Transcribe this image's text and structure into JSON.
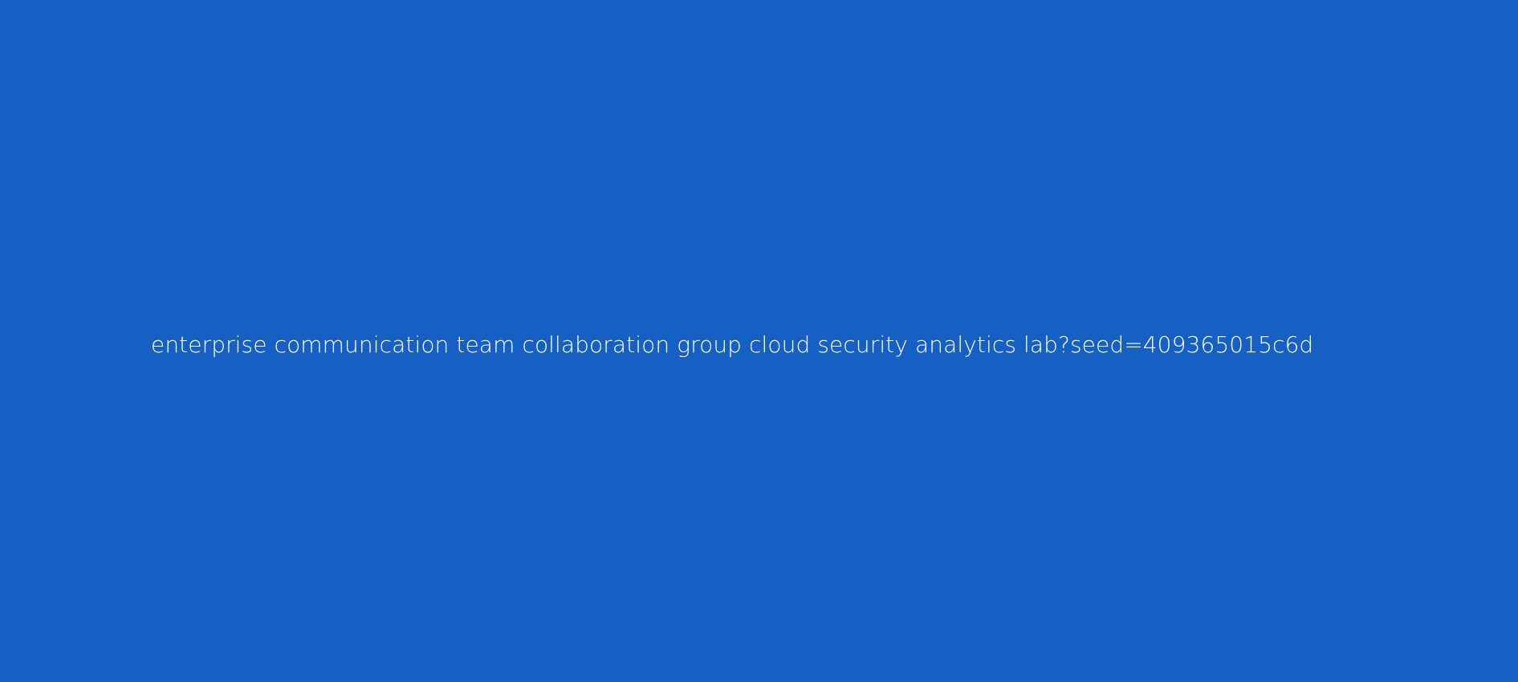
{
  "banner": {
    "text": "enterprise communication team collaboration group cloud security analytics lab?seed=409365015c6d",
    "background_color": "#1660c3",
    "text_color": "#ffffff"
  }
}
